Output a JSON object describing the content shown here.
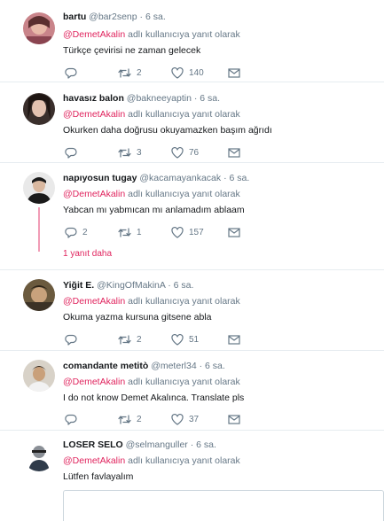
{
  "tweets": [
    {
      "name": "bartu",
      "handle": "@bar2senp",
      "time": "6 sa.",
      "reply_mention": "@DemetAkalin",
      "reply_suffix": "adlı kullanıcıya yanıt olarak",
      "text": "Türkçe çevirisi ne zaman gelecek",
      "replies": "",
      "retweets": "2",
      "likes": "140"
    },
    {
      "name": "havasız balon",
      "handle": "@bakneeyaptin",
      "time": "6 sa.",
      "reply_mention": "@DemetAkalin",
      "reply_suffix": "adlı kullanıcıya yanıt olarak",
      "text": "Okurken daha doğrusu okuyamazken başım ağrıdı",
      "replies": "",
      "retweets": "3",
      "likes": "76"
    },
    {
      "name": "napıyosun tugay",
      "handle": "@kacamayankacak",
      "time": "6 sa.",
      "reply_mention": "@DemetAkalin",
      "reply_suffix": "adlı kullanıcıya yanıt olarak",
      "text": "Yabcan mı yabmıcan mı anlamadım ablaam",
      "replies": "2",
      "retweets": "1",
      "likes": "157",
      "more_replies": "1 yanıt daha"
    },
    {
      "name": "Yiğit E.",
      "handle": "@KingOfMakinA",
      "time": "6 sa.",
      "reply_mention": "@DemetAkalin",
      "reply_suffix": "adlı kullanıcıya yanıt olarak",
      "text": "Okuma yazma kursuna gitsene abla",
      "replies": "",
      "retweets": "2",
      "likes": "51"
    },
    {
      "name": "comandante metitò",
      "handle": "@meterl34",
      "time": "6 sa.",
      "reply_mention": "@DemetAkalin",
      "reply_suffix": "adlı kullanıcıya yanıt olarak",
      "text": "I do not know Demet Akalınca. Translate pls",
      "replies": "",
      "retweets": "2",
      "likes": "37"
    },
    {
      "name": "LOSER SELO",
      "handle": "@selmanguller",
      "time": "6 sa.",
      "reply_mention": "@DemetAkalin",
      "reply_suffix": "adlı kullanıcıya yanıt olarak",
      "text": "Lütfen favlayalım"
    }
  ],
  "colors": {
    "accent": "#e0245e",
    "muted": "#657786",
    "text": "#14171a",
    "border": "#e6ecf0"
  }
}
